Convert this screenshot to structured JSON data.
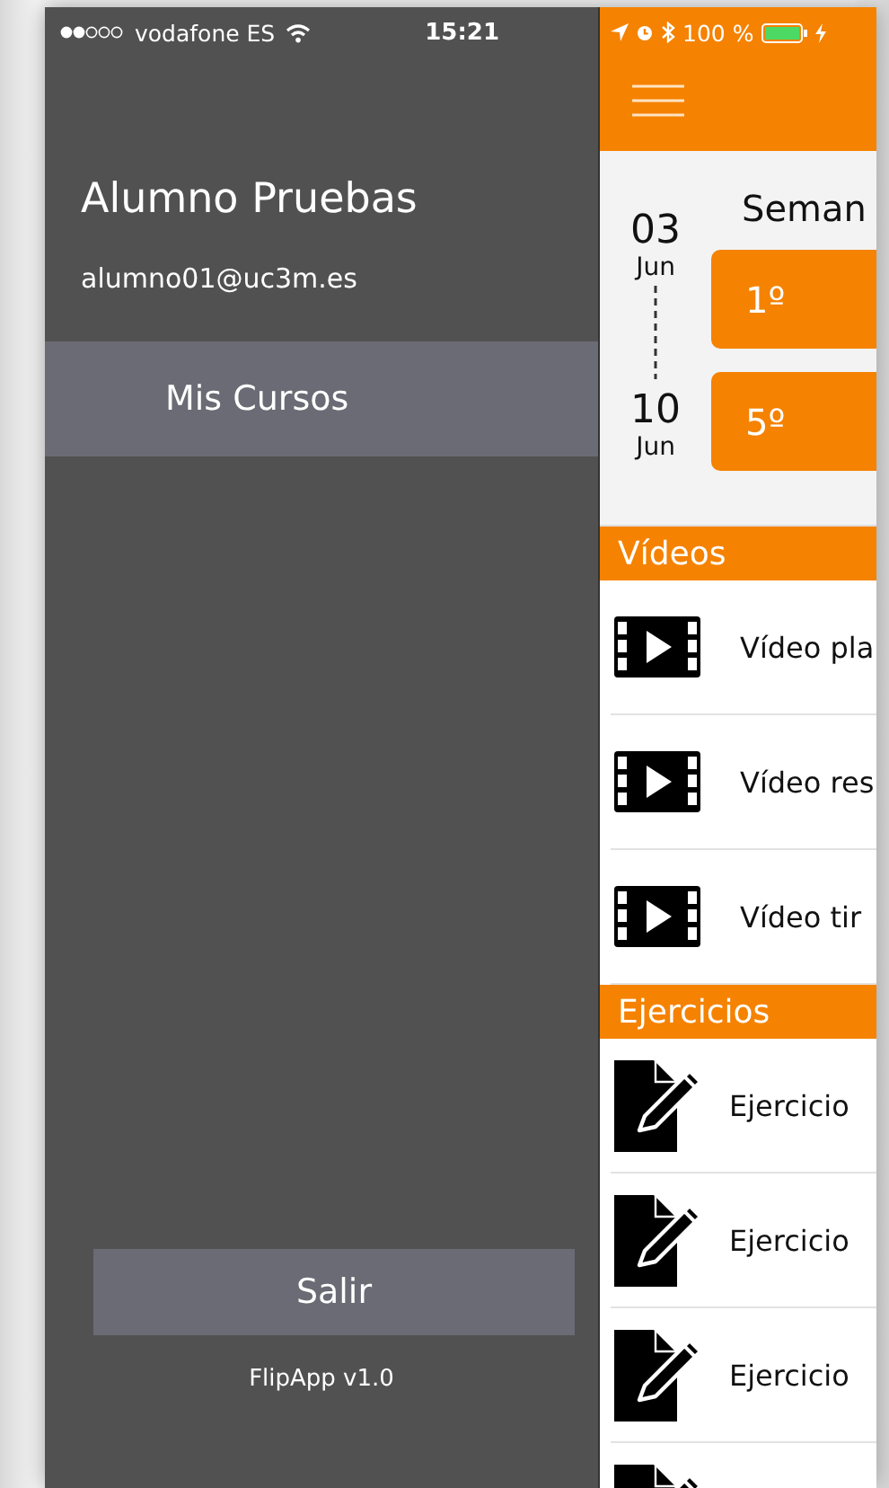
{
  "status_bar": {
    "carrier": "vodafone ES",
    "time": "15:21",
    "battery": "100 %"
  },
  "drawer": {
    "user_name": "Alumno Pruebas",
    "email": "alumno01@uc3m.es",
    "menu_items": [
      {
        "label": "Mis Cursos",
        "selected": true
      }
    ],
    "logout_button": "Salir",
    "version": "FlipApp v1.0"
  },
  "main": {
    "week": {
      "title": "Seman",
      "start": {
        "day": "03",
        "month": "Jun"
      },
      "end": {
        "day": "10",
        "month": "Jun"
      },
      "entries": [
        "1º",
        "5º"
      ]
    },
    "sections": [
      {
        "title": "Vídeos",
        "items": [
          {
            "kind": "video",
            "label": "Vídeo pla"
          },
          {
            "kind": "video",
            "label": "Vídeo res"
          },
          {
            "kind": "video",
            "label": "Vídeo tir"
          }
        ]
      },
      {
        "title": "Ejercicios",
        "items": [
          {
            "kind": "exercise",
            "label": "Ejercicio"
          },
          {
            "kind": "exercise",
            "label": "Ejercicio"
          },
          {
            "kind": "exercise",
            "label": "Ejercicio"
          },
          {
            "kind": "exercise"
          }
        ]
      }
    ]
  }
}
